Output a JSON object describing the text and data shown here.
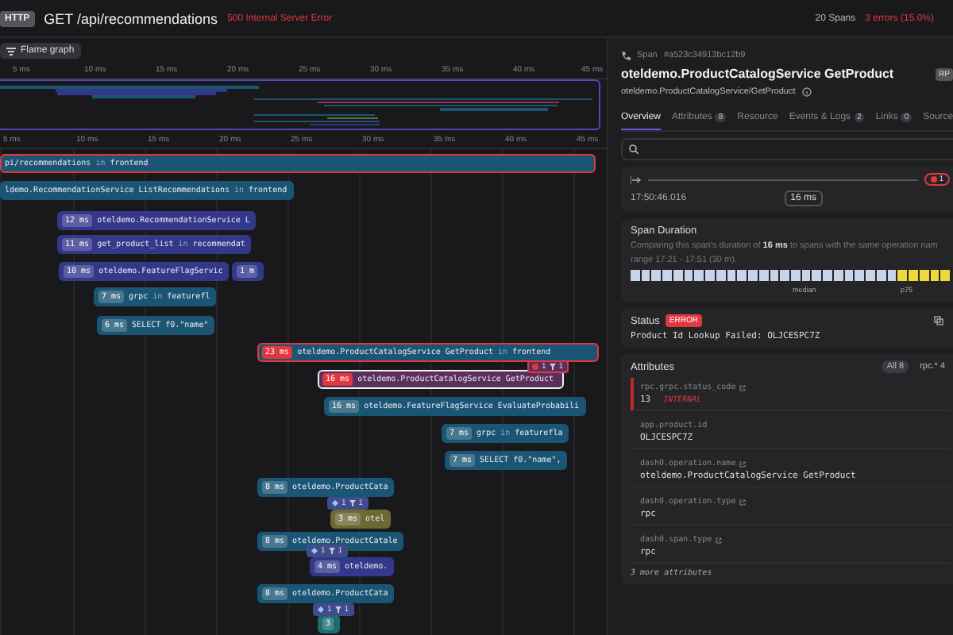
{
  "header": {
    "method_badge": "HTTP",
    "title": "GET /api/recommendations",
    "status": "500 Internal Server Error",
    "span_count": "20 Spans",
    "errors": "3 errors (15.0%)"
  },
  "toolbar": {
    "flame_button": "Flame graph"
  },
  "minimap": {
    "ticks": [
      "5 ms",
      "10 ms",
      "15 ms",
      "20 ms",
      "25 ms",
      "30 ms",
      "35 ms",
      "40 ms",
      "45 ms"
    ]
  },
  "timeline": {
    "ticks": [
      "5 ms",
      "10 ms",
      "15 ms",
      "20 ms",
      "25 ms",
      "30 ms",
      "35 ms",
      "40 ms",
      "45 ms"
    ],
    "spans": [
      {
        "operation": "pi/recommendations",
        "joiner": "in",
        "service": "frontend",
        "color": "#1b5574",
        "error": true,
        "selected": false
      },
      {
        "operation": "ldemo.RecommendationService ListRecommendations",
        "joiner": "in",
        "service": "frontend",
        "color": "#1b5574",
        "error": false,
        "selected": false
      },
      {
        "duration": "12 ms",
        "operation": "oteldemo.RecommendationService L",
        "color": "#34388a",
        "error": false,
        "selected": false
      },
      {
        "duration": "11 ms",
        "operation": "get_product_list",
        "joiner": "in",
        "service": "recommendat",
        "color": "#34388a",
        "error": false,
        "selected": false
      },
      {
        "duration": "10 ms",
        "operation": "oteldemo.FeatureFlagServic",
        "color": "#34388a",
        "error": false,
        "selected": false
      },
      {
        "duration": "1 m",
        "color": "#34388a",
        "error": false,
        "selected": false
      },
      {
        "duration": "7 ms",
        "operation": "grpc",
        "joiner": "in",
        "service": "featurefl",
        "color": "#1b5574",
        "error": false,
        "selected": false
      },
      {
        "duration": "6 ms",
        "operation": "SELECT f0.\"name\"",
        "color": "#1b5574",
        "error": false,
        "selected": false
      },
      {
        "duration": "23 ms",
        "operation": "oteldemo.ProductCatalogService GetProduct",
        "joiner": "in",
        "service": "frontend",
        "color": "#1b5574",
        "error": true,
        "selected": false
      },
      {
        "duration": "16 ms",
        "operation": "oteldemo.ProductCatalogService GetProduct",
        "color": "#5a2f5e",
        "error": true,
        "selected": true,
        "marker": {
          "kind": "error",
          "count": "1",
          "filter_count": "1"
        }
      },
      {
        "duration": "16 ms",
        "operation": "oteldemo.FeatureFlagService EvaluateProbabili",
        "color": "#1b5574",
        "error": false,
        "selected": false
      },
      {
        "duration": "7 ms",
        "operation": "grpc",
        "joiner": "in",
        "service": "featurefla",
        "color": "#1b5574",
        "error": false,
        "selected": false
      },
      {
        "duration": "7 ms",
        "operation": "SELECT f0.\"name\",",
        "color": "#1b5574",
        "error": false,
        "selected": false
      },
      {
        "duration": "8 ms",
        "operation": "oteldemo.ProductCata",
        "color": "#1b5574",
        "error": false,
        "selected": false
      },
      {
        "duration": "3 ms",
        "operation": "otel",
        "color": "#6b6a32",
        "error": false,
        "selected": false,
        "marker": {
          "kind": "event",
          "count": "1",
          "filter_count": "1"
        }
      },
      {
        "duration": "8 ms",
        "operation": "oteldemo.ProductCatale",
        "color": "#1b5574",
        "error": false,
        "selected": false
      },
      {
        "duration": "4 ms",
        "operation": "oteldemo.",
        "color": "#34388a",
        "error": false,
        "selected": false,
        "marker": {
          "kind": "event",
          "count": "1",
          "filter_count": "1"
        }
      },
      {
        "duration": "8 ms",
        "operation": "oteldemo.ProductCata",
        "color": "#1b5574",
        "error": false,
        "selected": false
      },
      {
        "duration": "3",
        "color": "#1d6e6e",
        "error": false,
        "selected": false,
        "marker": {
          "kind": "event",
          "count": "1",
          "filter_count": "1"
        }
      }
    ]
  },
  "span_panel": {
    "label": "Span",
    "id": "#a523c34913bc12b9",
    "title": "oteldemo.ProductCatalogService GetProduct",
    "type_badge": "RP",
    "subtitle": "oteldemo.ProductCatalogService/GetProduct",
    "tabs": [
      {
        "label": "Overview",
        "selected": true
      },
      {
        "label": "Attributes",
        "count": "8",
        "selected": false
      },
      {
        "label": "Resource",
        "selected": false
      },
      {
        "label": "Events & Logs",
        "count": "2",
        "selected": false
      },
      {
        "label": "Links",
        "count": "0",
        "selected": false
      },
      {
        "label": "Source",
        "selected": false
      }
    ],
    "timing": {
      "time": "17:50:46.016",
      "duration": "16 ms",
      "error_count": "1"
    },
    "duration_card": {
      "title": "Span Duration",
      "line_1": "Comparing this span's duration of **16 ms** to spans with the same operation nam",
      "line_2": "range 17:21 - 17:51 (30 m).",
      "median": "median",
      "p75": "p75"
    },
    "status": {
      "label": "Status",
      "badge": "ERROR",
      "message": "Product Id Lookup Failed: OLJCESPC7Z"
    },
    "attributes": {
      "title": "Attributes",
      "filters": [
        {
          "label": "All",
          "count": "8",
          "selected": true
        },
        {
          "label": "rpc.*",
          "count": "4",
          "selected": false
        }
      ],
      "items": [
        {
          "key": "rpc.grpc.status_code",
          "link": true,
          "value": "13",
          "note": "INTERNAL",
          "error": true
        },
        {
          "key": "app.product.id",
          "link": false,
          "value": "OLJCESPC7Z",
          "error": false
        },
        {
          "key": "dash0.operation.name",
          "link": true,
          "value": "oteldemo.ProductCatalogService GetProduct",
          "error": false
        },
        {
          "key": "dash0.operation.type",
          "link": true,
          "value": "rpc",
          "error": false
        },
        {
          "key": "dash0.span.type",
          "link": true,
          "value": "rpc",
          "error": false
        }
      ],
      "more": "3 more attributes"
    }
  }
}
